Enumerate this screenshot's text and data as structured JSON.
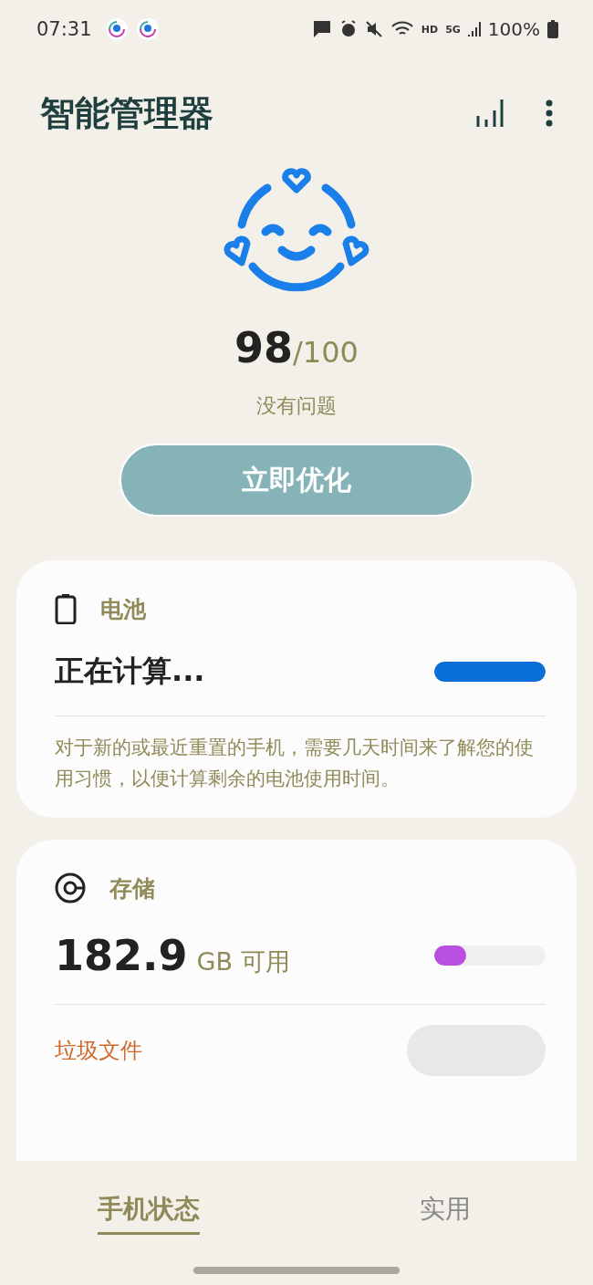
{
  "status_bar": {
    "time": "07:31",
    "extra": "HD",
    "network": "5G",
    "battery": "100%"
  },
  "app_bar": {
    "title": "智能管理器"
  },
  "score": {
    "value": "98",
    "max": "/100",
    "status": "没有问题"
  },
  "optimize_button": "立即优化",
  "battery_card": {
    "title": "电池",
    "value": "正在计算...",
    "level": 1,
    "description": "对于新的或最近重置的手机，需要几天时间来了解您的使用习惯，以便计算剩余的电池使用时间。"
  },
  "storage_card": {
    "title": "存储",
    "value": "182.9",
    "unit": "GB 可用",
    "level": 0.29,
    "junk_label": "垃圾文件"
  },
  "tabs": [
    {
      "label": "手机状态",
      "selected": true
    },
    {
      "label": "实用",
      "selected": false
    }
  ]
}
